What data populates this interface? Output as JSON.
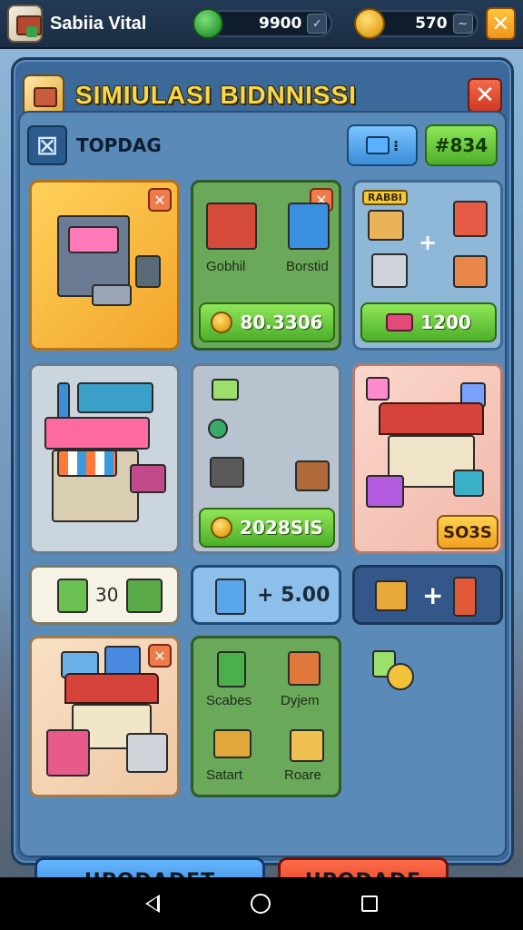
{
  "status_bar": {
    "app_name": "Sabiia Vital",
    "gems": "9900",
    "coins": "570"
  },
  "panel": {
    "title": "SIMIULASI BIDNNISSI"
  },
  "tab": {
    "label": "TOPDAG",
    "green_badge": "#834"
  },
  "cards": {
    "card_2": {
      "item_1": "Gobhil",
      "item_2": "Borstid",
      "price": "80.3306"
    },
    "card_3": {
      "tag": "RABBI",
      "price": "1200"
    },
    "card_5": {
      "price": "2028SIS"
    },
    "card_6": {
      "price": "SO3S"
    },
    "card_7": {
      "value": "30"
    },
    "card_8": {
      "value": "+ 5.00"
    },
    "card_11": {
      "item_1": "Scabes",
      "item_2": "Dyjem",
      "item_3": "Satart",
      "item_4": "Roare"
    }
  },
  "buttons": {
    "update_left": "UPODADET",
    "update_right": "UPODADE"
  },
  "colors": {
    "panel_blue": "#3b6a9a",
    "accent_green": "#4eaf2a",
    "accent_orange": "#f2a020",
    "accent_red": "#d8371e",
    "title_yellow": "#f7d84a"
  }
}
